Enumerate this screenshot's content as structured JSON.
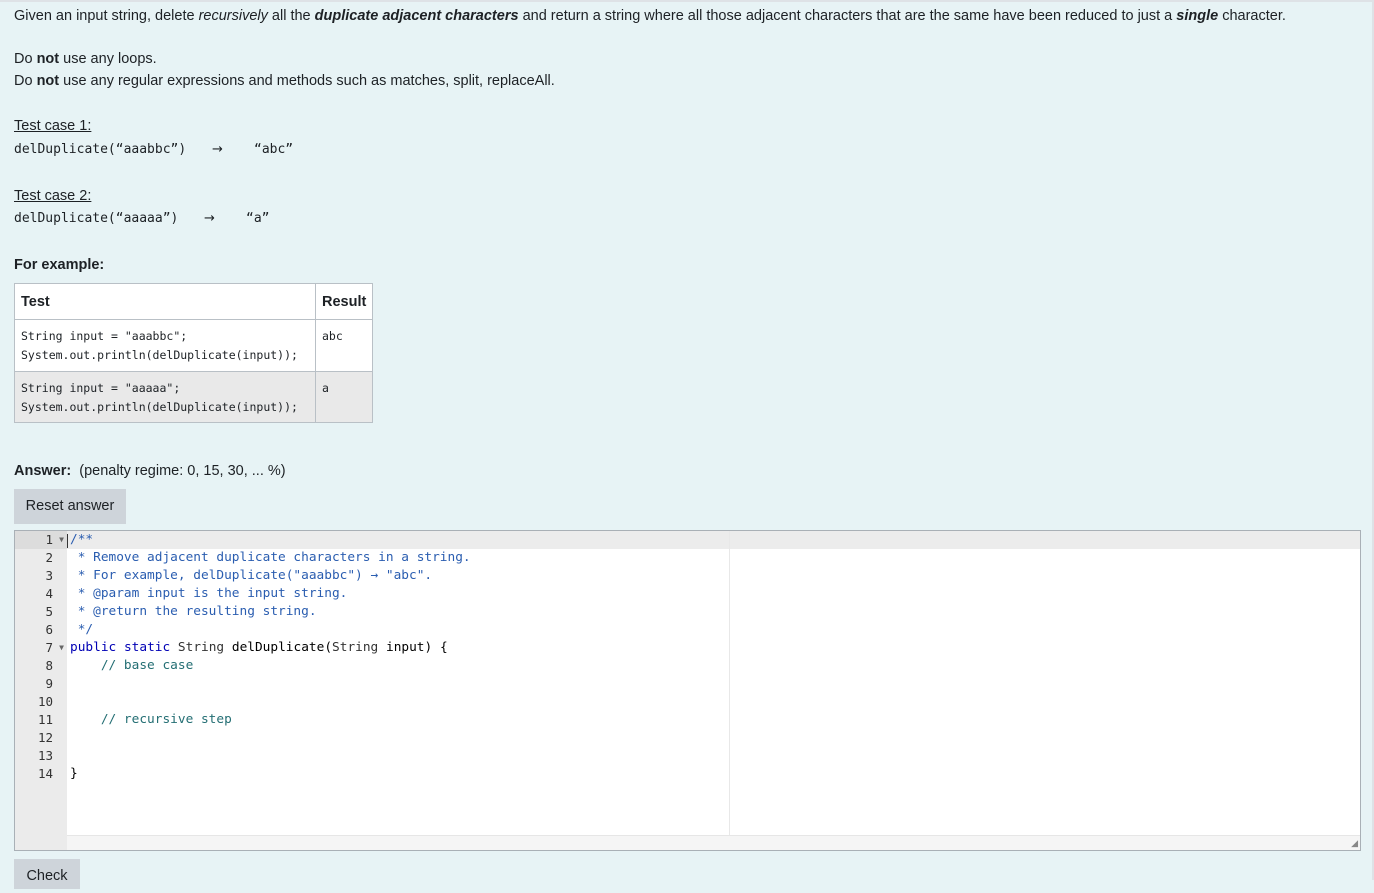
{
  "question": {
    "intro_1": "Given an input string, delete ",
    "intro_recursively": "recursively",
    "intro_2": " all the ",
    "intro_bold": "duplicate adjacent characters",
    "intro_3": " and return a string where all those adjacent characters that are the same have been reduced to just a ",
    "intro_single": "single",
    "intro_4": " character.",
    "rule1_pre": "Do ",
    "rule1_not": "not",
    "rule1_post": " use any loops.",
    "rule2_pre": "Do ",
    "rule2_not": "not",
    "rule2_post": " use any regular expressions and methods such as matches, split, replaceAll.",
    "test1_label": "Test case 1:",
    "test1_call": "delDuplicate(“aaabbc”)",
    "test1_arrow": "→",
    "test1_result": "“abc”",
    "test2_label": "Test case 2:",
    "test2_call": "delDuplicate(“aaaaa”)",
    "test2_arrow": "→",
    "test2_result": "“a”",
    "for_example": "For example:"
  },
  "example_table": {
    "headers": [
      "Test",
      "Result"
    ],
    "rows": [
      {
        "test": "String input = \"aaabbc\";\nSystem.out.println(delDuplicate(input));",
        "result": "abc"
      },
      {
        "test": "String input = \"aaaaa\";\nSystem.out.println(delDuplicate(input));",
        "result": "a"
      }
    ]
  },
  "answer": {
    "label": "Answer:",
    "penalty": "(penalty regime: 0, 15, 30, ... %)",
    "reset_button": "Reset answer",
    "check_button": "Check"
  },
  "editor": {
    "line_numbers": [
      "1",
      "2",
      "3",
      "4",
      "5",
      "6",
      "7",
      "8",
      "9",
      "10",
      "11",
      "12",
      "13",
      "14"
    ],
    "lines": [
      "/**",
      " * Remove adjacent duplicate characters in a string.",
      " * For example, delDuplicate(\"aaabbc\") → \"abc\".",
      " * @param input is the input string.",
      " * @return the resulting string.",
      " */",
      "public static String delDuplicate(String input) {",
      "    // base case",
      "",
      "",
      "    // recursive step",
      "",
      "",
      "}"
    ]
  }
}
